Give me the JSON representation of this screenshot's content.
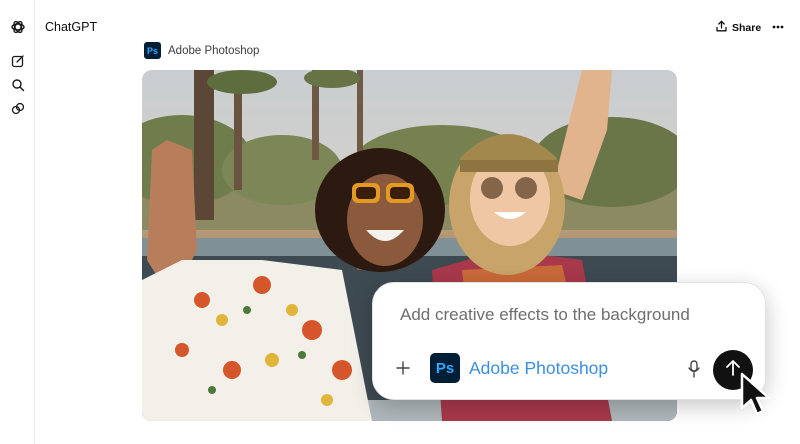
{
  "app": {
    "title": "ChatGPT"
  },
  "sidebar": {
    "icons": [
      "openai-logo-icon",
      "new-chat-icon",
      "search-icon",
      "library-icon"
    ]
  },
  "header": {
    "share_label": "Share",
    "more_icon": "ellipsis-icon"
  },
  "message": {
    "tool_name": "Adobe Photoshop",
    "tool_badge": "Ps",
    "image_alt": "Two women laughing in a convertible car in the desert"
  },
  "composer": {
    "prompt": "Add creative effects to the background",
    "tool_badge": "Ps",
    "tool_label": "Adobe Photoshop",
    "icons": [
      "plus-icon",
      "microphone-icon",
      "arrow-up-icon"
    ]
  },
  "colors": {
    "ps_background": "#001e36",
    "ps_accent": "#31a8ff",
    "tool_link": "#3b8fe0",
    "send_button": "#111111"
  }
}
